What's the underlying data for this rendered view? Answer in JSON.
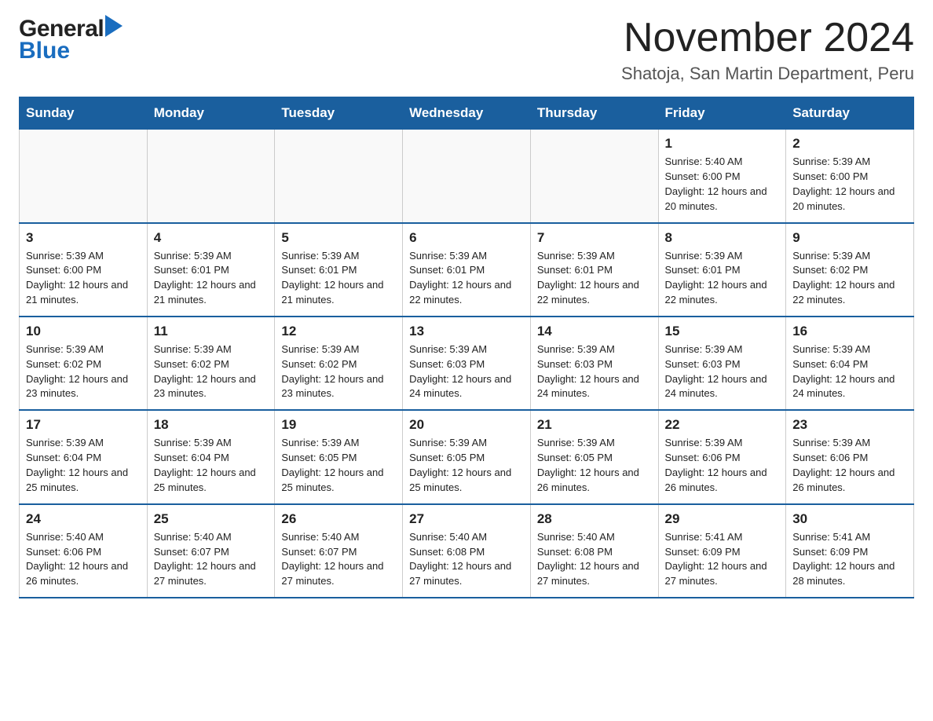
{
  "header": {
    "logo": {
      "general_text": "General",
      "blue_text": "Blue"
    },
    "month_title": "November 2024",
    "location": "Shatoja, San Martin Department, Peru"
  },
  "days_of_week": [
    "Sunday",
    "Monday",
    "Tuesday",
    "Wednesday",
    "Thursday",
    "Friday",
    "Saturday"
  ],
  "weeks": [
    [
      {
        "day": "",
        "sunrise": "",
        "sunset": "",
        "daylight": "",
        "empty": true
      },
      {
        "day": "",
        "sunrise": "",
        "sunset": "",
        "daylight": "",
        "empty": true
      },
      {
        "day": "",
        "sunrise": "",
        "sunset": "",
        "daylight": "",
        "empty": true
      },
      {
        "day": "",
        "sunrise": "",
        "sunset": "",
        "daylight": "",
        "empty": true
      },
      {
        "day": "",
        "sunrise": "",
        "sunset": "",
        "daylight": "",
        "empty": true
      },
      {
        "day": "1",
        "sunrise": "Sunrise: 5:40 AM",
        "sunset": "Sunset: 6:00 PM",
        "daylight": "Daylight: 12 hours and 20 minutes.",
        "empty": false
      },
      {
        "day": "2",
        "sunrise": "Sunrise: 5:39 AM",
        "sunset": "Sunset: 6:00 PM",
        "daylight": "Daylight: 12 hours and 20 minutes.",
        "empty": false
      }
    ],
    [
      {
        "day": "3",
        "sunrise": "Sunrise: 5:39 AM",
        "sunset": "Sunset: 6:00 PM",
        "daylight": "Daylight: 12 hours and 21 minutes.",
        "empty": false
      },
      {
        "day": "4",
        "sunrise": "Sunrise: 5:39 AM",
        "sunset": "Sunset: 6:01 PM",
        "daylight": "Daylight: 12 hours and 21 minutes.",
        "empty": false
      },
      {
        "day": "5",
        "sunrise": "Sunrise: 5:39 AM",
        "sunset": "Sunset: 6:01 PM",
        "daylight": "Daylight: 12 hours and 21 minutes.",
        "empty": false
      },
      {
        "day": "6",
        "sunrise": "Sunrise: 5:39 AM",
        "sunset": "Sunset: 6:01 PM",
        "daylight": "Daylight: 12 hours and 22 minutes.",
        "empty": false
      },
      {
        "day": "7",
        "sunrise": "Sunrise: 5:39 AM",
        "sunset": "Sunset: 6:01 PM",
        "daylight": "Daylight: 12 hours and 22 minutes.",
        "empty": false
      },
      {
        "day": "8",
        "sunrise": "Sunrise: 5:39 AM",
        "sunset": "Sunset: 6:01 PM",
        "daylight": "Daylight: 12 hours and 22 minutes.",
        "empty": false
      },
      {
        "day": "9",
        "sunrise": "Sunrise: 5:39 AM",
        "sunset": "Sunset: 6:02 PM",
        "daylight": "Daylight: 12 hours and 22 minutes.",
        "empty": false
      }
    ],
    [
      {
        "day": "10",
        "sunrise": "Sunrise: 5:39 AM",
        "sunset": "Sunset: 6:02 PM",
        "daylight": "Daylight: 12 hours and 23 minutes.",
        "empty": false
      },
      {
        "day": "11",
        "sunrise": "Sunrise: 5:39 AM",
        "sunset": "Sunset: 6:02 PM",
        "daylight": "Daylight: 12 hours and 23 minutes.",
        "empty": false
      },
      {
        "day": "12",
        "sunrise": "Sunrise: 5:39 AM",
        "sunset": "Sunset: 6:02 PM",
        "daylight": "Daylight: 12 hours and 23 minutes.",
        "empty": false
      },
      {
        "day": "13",
        "sunrise": "Sunrise: 5:39 AM",
        "sunset": "Sunset: 6:03 PM",
        "daylight": "Daylight: 12 hours and 24 minutes.",
        "empty": false
      },
      {
        "day": "14",
        "sunrise": "Sunrise: 5:39 AM",
        "sunset": "Sunset: 6:03 PM",
        "daylight": "Daylight: 12 hours and 24 minutes.",
        "empty": false
      },
      {
        "day": "15",
        "sunrise": "Sunrise: 5:39 AM",
        "sunset": "Sunset: 6:03 PM",
        "daylight": "Daylight: 12 hours and 24 minutes.",
        "empty": false
      },
      {
        "day": "16",
        "sunrise": "Sunrise: 5:39 AM",
        "sunset": "Sunset: 6:04 PM",
        "daylight": "Daylight: 12 hours and 24 minutes.",
        "empty": false
      }
    ],
    [
      {
        "day": "17",
        "sunrise": "Sunrise: 5:39 AM",
        "sunset": "Sunset: 6:04 PM",
        "daylight": "Daylight: 12 hours and 25 minutes.",
        "empty": false
      },
      {
        "day": "18",
        "sunrise": "Sunrise: 5:39 AM",
        "sunset": "Sunset: 6:04 PM",
        "daylight": "Daylight: 12 hours and 25 minutes.",
        "empty": false
      },
      {
        "day": "19",
        "sunrise": "Sunrise: 5:39 AM",
        "sunset": "Sunset: 6:05 PM",
        "daylight": "Daylight: 12 hours and 25 minutes.",
        "empty": false
      },
      {
        "day": "20",
        "sunrise": "Sunrise: 5:39 AM",
        "sunset": "Sunset: 6:05 PM",
        "daylight": "Daylight: 12 hours and 25 minutes.",
        "empty": false
      },
      {
        "day": "21",
        "sunrise": "Sunrise: 5:39 AM",
        "sunset": "Sunset: 6:05 PM",
        "daylight": "Daylight: 12 hours and 26 minutes.",
        "empty": false
      },
      {
        "day": "22",
        "sunrise": "Sunrise: 5:39 AM",
        "sunset": "Sunset: 6:06 PM",
        "daylight": "Daylight: 12 hours and 26 minutes.",
        "empty": false
      },
      {
        "day": "23",
        "sunrise": "Sunrise: 5:39 AM",
        "sunset": "Sunset: 6:06 PM",
        "daylight": "Daylight: 12 hours and 26 minutes.",
        "empty": false
      }
    ],
    [
      {
        "day": "24",
        "sunrise": "Sunrise: 5:40 AM",
        "sunset": "Sunset: 6:06 PM",
        "daylight": "Daylight: 12 hours and 26 minutes.",
        "empty": false
      },
      {
        "day": "25",
        "sunrise": "Sunrise: 5:40 AM",
        "sunset": "Sunset: 6:07 PM",
        "daylight": "Daylight: 12 hours and 27 minutes.",
        "empty": false
      },
      {
        "day": "26",
        "sunrise": "Sunrise: 5:40 AM",
        "sunset": "Sunset: 6:07 PM",
        "daylight": "Daylight: 12 hours and 27 minutes.",
        "empty": false
      },
      {
        "day": "27",
        "sunrise": "Sunrise: 5:40 AM",
        "sunset": "Sunset: 6:08 PM",
        "daylight": "Daylight: 12 hours and 27 minutes.",
        "empty": false
      },
      {
        "day": "28",
        "sunrise": "Sunrise: 5:40 AM",
        "sunset": "Sunset: 6:08 PM",
        "daylight": "Daylight: 12 hours and 27 minutes.",
        "empty": false
      },
      {
        "day": "29",
        "sunrise": "Sunrise: 5:41 AM",
        "sunset": "Sunset: 6:09 PM",
        "daylight": "Daylight: 12 hours and 27 minutes.",
        "empty": false
      },
      {
        "day": "30",
        "sunrise": "Sunrise: 5:41 AM",
        "sunset": "Sunset: 6:09 PM",
        "daylight": "Daylight: 12 hours and 28 minutes.",
        "empty": false
      }
    ]
  ]
}
